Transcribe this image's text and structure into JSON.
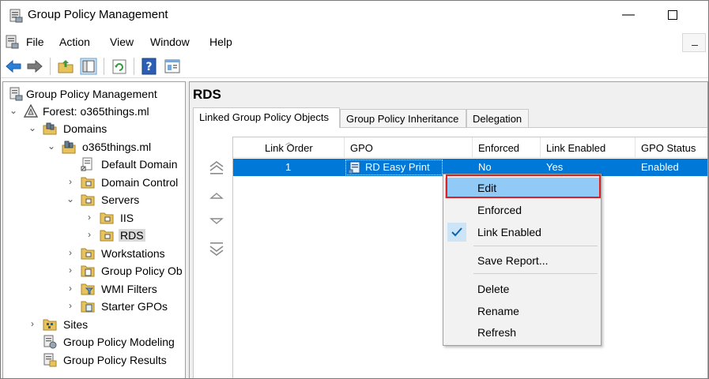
{
  "window": {
    "title": "Group Policy Management"
  },
  "menu": {
    "items": [
      "File",
      "Action",
      "View",
      "Window",
      "Help"
    ]
  },
  "toolbar": {
    "icons": [
      "back-arrow-icon",
      "forward-arrow-icon",
      "up-folder-icon",
      "show-hide-tree-icon",
      "refresh-icon",
      "help-icon",
      "properties-icon"
    ]
  },
  "tree": {
    "items": [
      {
        "label": "Group Policy Management",
        "icon": "gpm-icon"
      },
      {
        "label": "Forest: o365things.ml",
        "icon": "forest-icon"
      },
      {
        "label": "Domains",
        "icon": "domains-icon"
      },
      {
        "label": "o365things.ml",
        "icon": "domain-icon"
      },
      {
        "label": "Default Domain",
        "icon": "gpo-link-icon"
      },
      {
        "label": "Domain Control",
        "icon": "ou-icon"
      },
      {
        "label": "Servers",
        "icon": "ou-icon"
      },
      {
        "label": "IIS",
        "icon": "ou-icon"
      },
      {
        "label": "RDS",
        "icon": "ou-icon"
      },
      {
        "label": "Workstations",
        "icon": "ou-icon"
      },
      {
        "label": "Group Policy Ob",
        "icon": "gpo-container-icon"
      },
      {
        "label": "WMI Filters",
        "icon": "wmi-folder-icon"
      },
      {
        "label": "Starter GPOs",
        "icon": "starter-gpo-icon"
      },
      {
        "label": "Sites",
        "icon": "sites-icon"
      },
      {
        "label": "Group Policy Modeling",
        "icon": "modeling-icon"
      },
      {
        "label": "Group Policy Results",
        "icon": "results-icon"
      }
    ]
  },
  "details": {
    "heading": "RDS",
    "tabs": [
      "Linked Group Policy Objects",
      "Group Policy Inheritance",
      "Delegation"
    ],
    "columns": [
      "Link Order",
      "GPO",
      "Enforced",
      "Link Enabled",
      "GPO Status"
    ],
    "rows": [
      {
        "link_order": "1",
        "gpo": "RD Easy Print",
        "enforced": "No",
        "link_enabled": "Yes",
        "status": "Enabled"
      }
    ]
  },
  "context_menu": {
    "items": [
      "Edit",
      "Enforced",
      "Link Enabled",
      "Save Report...",
      "Delete",
      "Rename",
      "Refresh"
    ]
  },
  "colors": {
    "selection": "#0078d7",
    "menu_highlight": "#91c9f7",
    "annotation": "#e02020"
  }
}
